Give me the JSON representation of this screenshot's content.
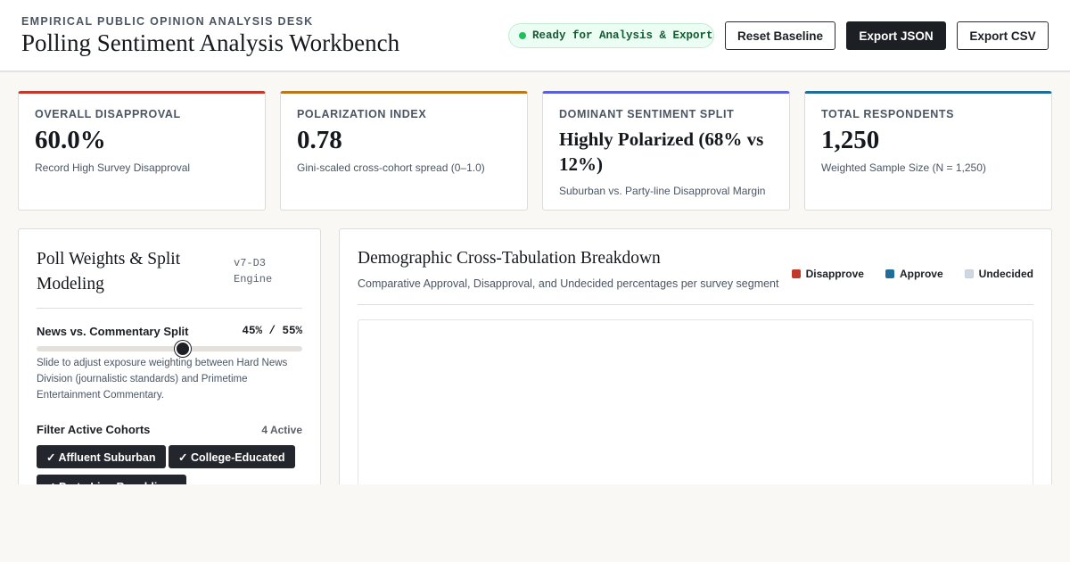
{
  "header": {
    "eyebrow": "EMPIRICAL PUBLIC OPINION ANALYSIS DESK",
    "title": "Polling Sentiment Analysis Workbench",
    "status": "Ready for Analysis & Export",
    "buttons": {
      "reset": "Reset Baseline",
      "export_json": "Export JSON",
      "export_csv": "Export CSV"
    }
  },
  "kpis": [
    {
      "label": "OVERALL DISAPPROVAL",
      "value": "60.0%",
      "sub": "Record High Survey Disapproval",
      "accent": "#c0392b"
    },
    {
      "label": "POLARIZATION INDEX",
      "value": "0.78",
      "sub": "Gini-scaled cross-cohort spread (0–1.0)",
      "accent": "#b9771e"
    },
    {
      "label": "DOMINANT SENTIMENT SPLIT",
      "value": "Highly Polarized (68% vs 12%)",
      "sub": "Suburban vs. Party-line Disapproval Margin",
      "accent": "#5b5fd6"
    },
    {
      "label": "TOTAL RESPONDENTS",
      "value": "1,250",
      "sub": "Weighted Sample Size (N = 1,250)",
      "accent": "#1f6e9a"
    }
  ],
  "controls": {
    "title": "Poll Weights & Split Modeling",
    "engine": "v7-D3 Engine",
    "split_label": "News vs. Commentary Split",
    "split_value": "45% / 55%",
    "split_news_fraction": 0.55,
    "split_help": "Slide to adjust exposure weighting between Hard News Division (journalistic standards) and Primetime Entertainment Commentary.",
    "cohort_label": "Filter Active Cohorts",
    "cohort_count": "4 Active",
    "cohorts": [
      "✓ Affluent Suburban",
      "✓ College-Educated",
      "✓ Party-Line Republican"
    ]
  },
  "breakdown": {
    "title": "Demographic Cross-Tabulation Breakdown",
    "subtitle": "Comparative Approval, Disapproval, and Undecided percentages per survey segment",
    "legend": [
      {
        "label": "Disapprove",
        "color": "#c0392b"
      },
      {
        "label": "Approve",
        "color": "#1f6e9a"
      },
      {
        "label": "Undecided",
        "color": "#cfd8e0"
      }
    ]
  },
  "colors": {
    "status_green": "#1fbf5d",
    "ink": "#1c1f24"
  },
  "icons": {
    "status": "status-dot-icon",
    "slider": "slider-thumb"
  }
}
